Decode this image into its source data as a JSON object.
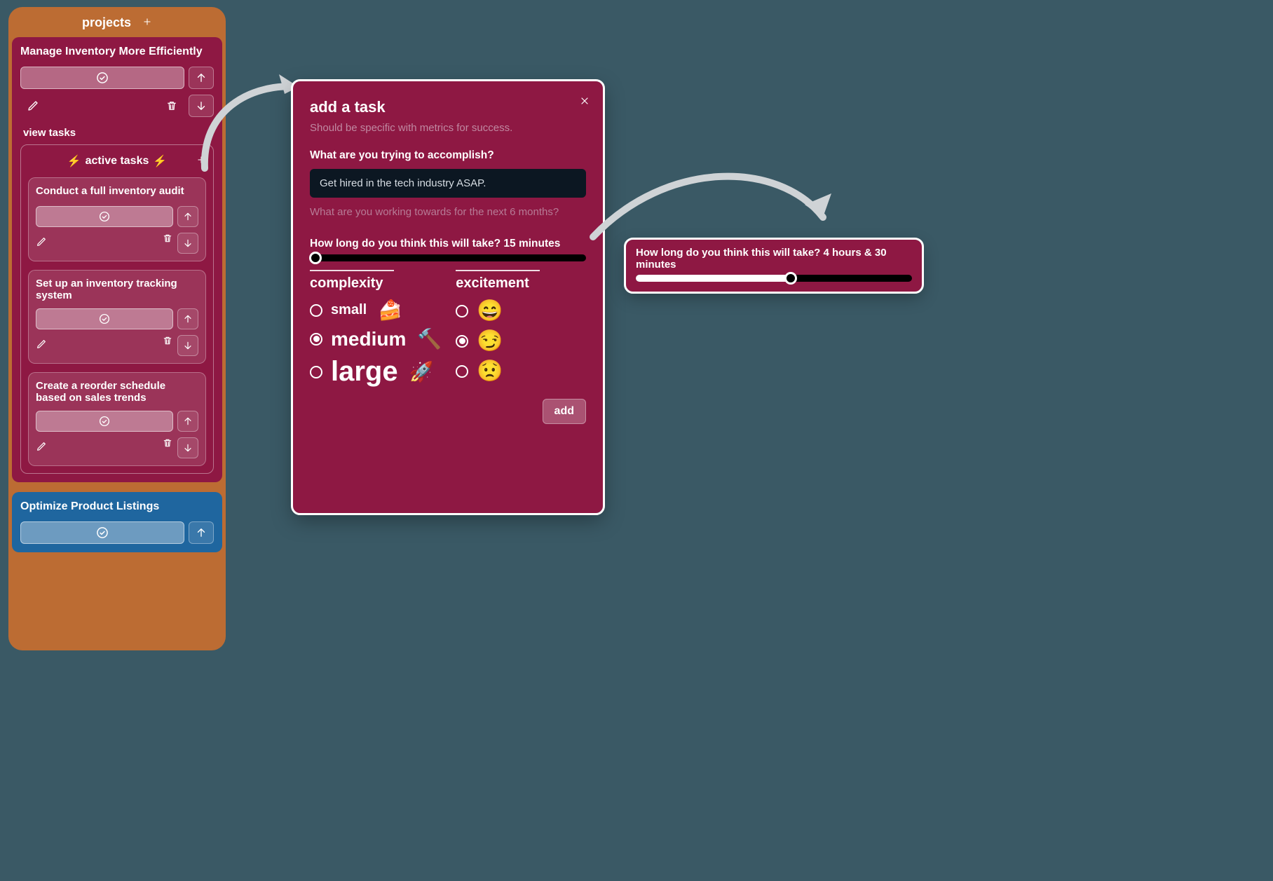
{
  "sidebar": {
    "header": "projects",
    "project1_title": "Manage Inventory More Efficiently",
    "view_tasks_label": "view tasks",
    "active_tasks_label": "active tasks",
    "tasks": [
      {
        "title": "Conduct a full inventory audit"
      },
      {
        "title": "Set up an inventory tracking system"
      },
      {
        "title": "Create a reorder schedule based on sales trends"
      }
    ],
    "project2_title": "Optimize Product Listings"
  },
  "modal": {
    "title": "add a task",
    "subtitle": "Should be specific with metrics for success.",
    "question": "What are you trying to accomplish?",
    "input_value": "Get hired in the tech industry ASAP.",
    "hint": "What are you working towards for the next 6 months?",
    "slider_label": "How long do you think this will take? 15 minutes",
    "slider_fill_pct": 2,
    "complexity_header": "complexity",
    "complexity": [
      {
        "label": "small",
        "emoji": "🍰",
        "size": "c-small",
        "checked": false
      },
      {
        "label": "medium",
        "emoji": "🔨",
        "size": "c-medium",
        "checked": true
      },
      {
        "label": "large",
        "emoji": "🚀",
        "size": "c-large",
        "checked": false
      }
    ],
    "excitement_header": "excitement",
    "excitement": [
      {
        "emoji": "😄",
        "checked": false
      },
      {
        "emoji": "😏",
        "checked": true
      },
      {
        "emoji": "😟",
        "checked": false
      }
    ],
    "add_button": "add"
  },
  "capsule": {
    "slider_label": "How long do you think this will take? 4 hours & 30 minutes",
    "slider_fill_pct": 56
  },
  "icons": {
    "bolt": "⚡"
  }
}
